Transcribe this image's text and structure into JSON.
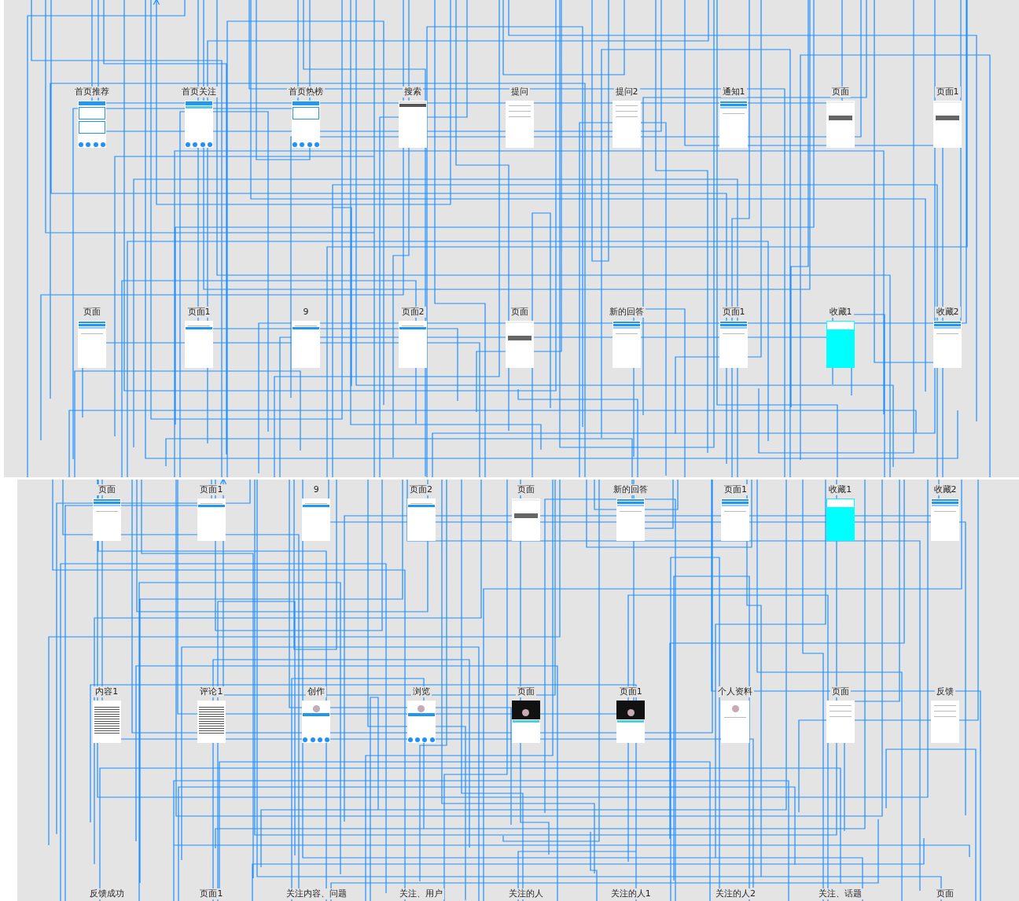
{
  "panels": [
    {
      "rows": [
        [
          {
            "title": "首页推荐",
            "kind": "feed"
          },
          {
            "title": "首页关注",
            "kind": "tabs"
          },
          {
            "title": "首页热榜",
            "kind": "hot"
          },
          {
            "title": "搜索",
            "kind": "search"
          },
          {
            "title": "提问",
            "kind": "form"
          },
          {
            "title": "提问2",
            "kind": "form"
          },
          {
            "title": "通知1",
            "kind": "list"
          },
          {
            "title": "页面",
            "kind": "button"
          },
          {
            "title": "页面1",
            "kind": "button"
          }
        ],
        [
          {
            "title": "页面",
            "kind": "list"
          },
          {
            "title": "页面1",
            "kind": "footer"
          },
          {
            "title": "9",
            "kind": "footer"
          },
          {
            "title": "页面2",
            "kind": "footer"
          },
          {
            "title": "页面",
            "kind": "button"
          },
          {
            "title": "新的回答",
            "kind": "list"
          },
          {
            "title": "页面1",
            "kind": "list"
          },
          {
            "title": "收藏1",
            "kind": "cyan"
          },
          {
            "title": "收藏2",
            "kind": "list"
          }
        ]
      ]
    },
    {
      "rows": [
        [
          {
            "title": "页面",
            "kind": "list"
          },
          {
            "title": "页面1",
            "kind": "footer"
          },
          {
            "title": "9",
            "kind": "footer"
          },
          {
            "title": "页面2",
            "kind": "footer"
          },
          {
            "title": "页面",
            "kind": "button"
          },
          {
            "title": "新的回答",
            "kind": "list"
          },
          {
            "title": "页面1",
            "kind": "list"
          },
          {
            "title": "收藏1",
            "kind": "cyan"
          },
          {
            "title": "收藏2",
            "kind": "list"
          }
        ],
        [
          {
            "title": "内容1",
            "kind": "text"
          },
          {
            "title": "评论1",
            "kind": "text"
          },
          {
            "title": "创作",
            "kind": "profile"
          },
          {
            "title": "浏览",
            "kind": "profile"
          },
          {
            "title": "页面",
            "kind": "photo"
          },
          {
            "title": "页面1",
            "kind": "photo"
          },
          {
            "title": "个人资料",
            "kind": "avatar"
          },
          {
            "title": "页面",
            "kind": "form"
          },
          {
            "title": "反馈",
            "kind": "form"
          }
        ],
        [
          {
            "title": "反馈成功",
            "kind": "none"
          },
          {
            "title": "页面1",
            "kind": "none"
          },
          {
            "title": "关注内容、问题",
            "kind": "none"
          },
          {
            "title": "关注、用户",
            "kind": "none"
          },
          {
            "title": "关注的人",
            "kind": "none"
          },
          {
            "title": "关注的人1",
            "kind": "none"
          },
          {
            "title": "关注的人2",
            "kind": "none"
          },
          {
            "title": "关注、话题",
            "kind": "none"
          },
          {
            "title": "页面",
            "kind": "none"
          }
        ]
      ]
    }
  ]
}
